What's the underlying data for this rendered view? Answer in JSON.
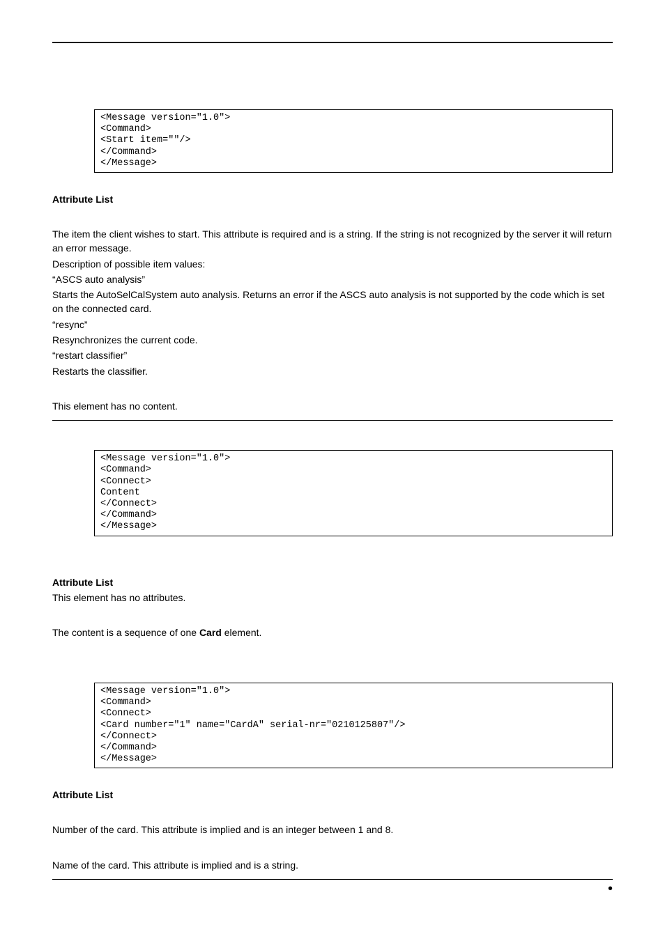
{
  "codeBlocks": {
    "one": "<Message version=\"1.0\">\n<Command>\n<Start item=\"\"/>\n</Command>\n</Message>",
    "two": "<Message version=\"1.0\">\n<Command>\n<Connect>\nContent\n</Connect>\n</Command>\n</Message>",
    "three": "<Message version=\"1.0\">\n<Command>\n<Connect>\n<Card number=\"1\" name=\"CardA\" serial-nr=\"0210125807\"/>\n</Connect>\n</Command>\n</Message>"
  },
  "headings": {
    "attrList": "Attribute List"
  },
  "section1": {
    "p1": "The item the client wishes to start. This attribute is required and is a string. If the string is not recognized by the server it will return an error message.",
    "p2": "Description of possible item values:",
    "p3": "“ASCS auto analysis”",
    "p4": "Starts the AutoSelCalSystem auto analysis. Returns an error if the ASCS auto analysis is not supported by the code which is set on the connected card.",
    "p5": "“resync”",
    "p6": "Resynchronizes the current code.",
    "p7": "“restart classifier”",
    "p8": "Restarts the classifier.",
    "p9": "This element has no content."
  },
  "section2": {
    "p1": "This element has no attributes.",
    "p2a": "The content is a sequence of one ",
    "p2b": "Card",
    "p2c": " element."
  },
  "section3": {
    "p1": "Number of the card. This attribute is implied and is an integer between 1 and 8.",
    "p2": "Name of the card. This attribute is implied and is a string."
  },
  "footerDot": "•"
}
